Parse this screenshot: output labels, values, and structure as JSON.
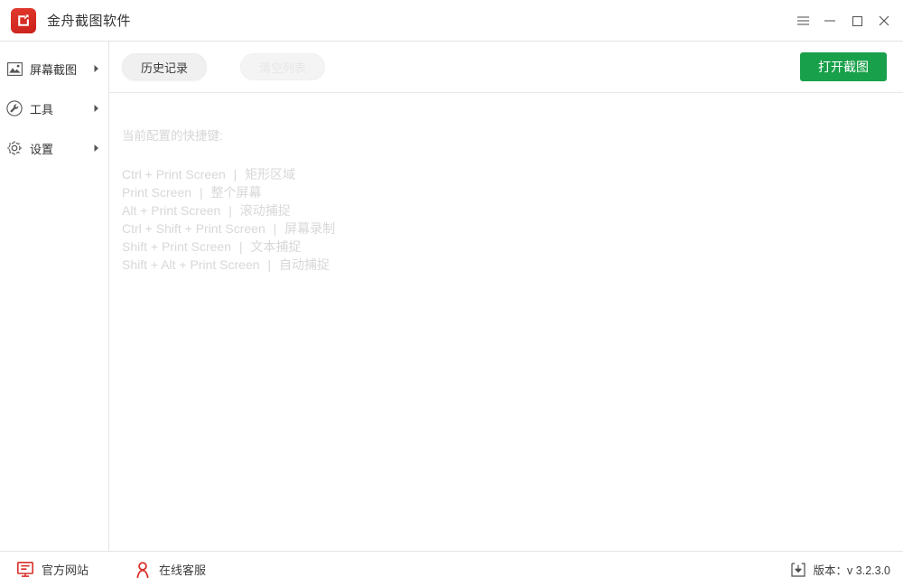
{
  "window": {
    "title": "金舟截图软件",
    "logo_icon": "app-logo-icon",
    "controls": [
      {
        "name": "menu-button",
        "icon": "hamburger-menu-icon",
        "label": "菜单"
      },
      {
        "name": "minimize-button",
        "icon": "minimize-icon",
        "label": "最小化"
      },
      {
        "name": "maximize-button",
        "icon": "maximize-icon",
        "label": "最大化"
      },
      {
        "name": "close-button",
        "icon": "close-icon",
        "label": "关闭"
      }
    ]
  },
  "sidebar": {
    "items": [
      {
        "label": "屏幕截图",
        "icon": "image-icon",
        "chevron": "chevron-right-icon"
      },
      {
        "label": "工具",
        "icon": "wrench-icon",
        "chevron": "chevron-right-icon"
      },
      {
        "label": "设置",
        "icon": "gear-icon",
        "chevron": "chevron-right-icon"
      }
    ]
  },
  "toolbar": {
    "history_label": "历史记录",
    "clear_list_label": "清空列表",
    "open_screenshot_label": "打开截图",
    "open_screenshot_color": "#18a04a"
  },
  "content": {
    "heading": "当前配置的快捷键:",
    "shortcuts": [
      {
        "keys": "Ctrl + Print Screen",
        "sep": "|",
        "action": "矩形区域"
      },
      {
        "keys": "Print Screen",
        "sep": "|",
        "action": "整个屏幕"
      },
      {
        "keys": "Alt + Print Screen",
        "sep": "|",
        "action": "滚动捕捉"
      },
      {
        "keys": "Ctrl + Shift + Print Screen",
        "sep": "|",
        "action": "屏幕录制"
      },
      {
        "keys": "Shift + Print Screen",
        "sep": "|",
        "action": "文本捕捉"
      },
      {
        "keys": "Shift + Alt + Print Screen",
        "sep": "|",
        "action": "自动捕捉"
      }
    ]
  },
  "footer": {
    "website_label": "官方网站",
    "website_icon": "monitor-icon",
    "support_label": "在线客服",
    "support_icon": "user-icon",
    "version_icon": "download-icon",
    "version_text": "版本：v 3.2.3.0",
    "accent_color": "#d9302a"
  }
}
